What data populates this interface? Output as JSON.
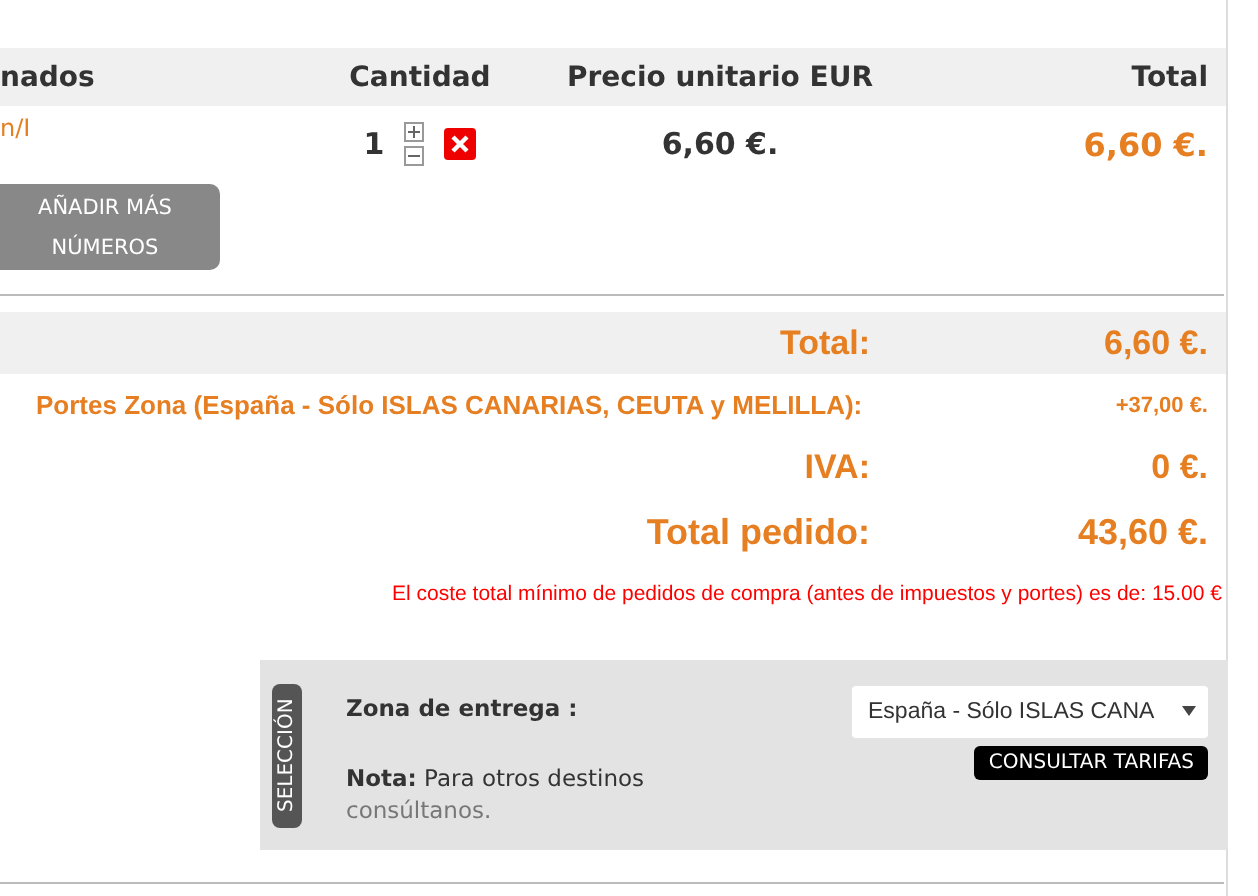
{
  "table": {
    "columns": [
      "nados",
      "Cantidad",
      "Precio unitario EUR",
      "Total"
    ],
    "rows": [
      {
        "name": "n/I",
        "quantity": "1",
        "unit_price": "6,60 €.",
        "total": "6,60 €."
      }
    ]
  },
  "add_button": "AÑADIR MÁS NÚMEROS",
  "summary": [
    {
      "kind": "total",
      "label": "Total:",
      "value": "6,60 €.",
      "shaded": true
    },
    {
      "kind": "shipping",
      "label": "Portes Zona  (España - Sólo ISLAS CANARIAS, CEUTA y MELILLA):",
      "value": "+37,00 €.",
      "shaded": false
    },
    {
      "kind": "total",
      "label": "IVA:",
      "value": "0 €.",
      "shaded": false
    },
    {
      "kind": "grand",
      "label": "Total pedido:",
      "value": "43,60 €.",
      "shaded": false
    }
  ],
  "minimum_note": "El coste total mínimo de pedidos de compra (antes de impuestos y portes) es de: 15.00 €",
  "selection": {
    "tab": "SELECCIÓN",
    "zone_label": "Zona de entrega :",
    "zone_value": "España - Sólo ISLAS CANA",
    "note_label": "Nota:",
    "note_text": "Para otros destinos",
    "note_link": "consúltanos.",
    "button": "CONSULTAR TARIFAS"
  }
}
